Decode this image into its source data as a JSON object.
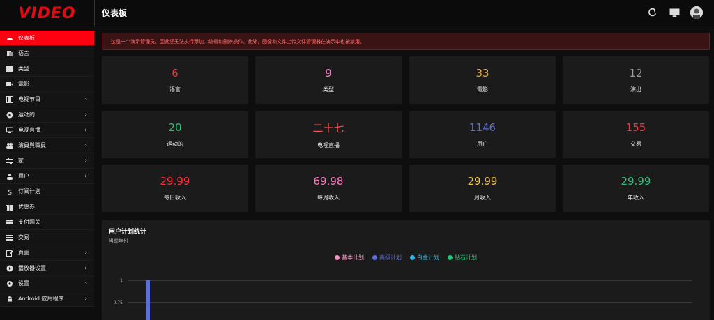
{
  "app": {
    "logo": "VIDEO",
    "page_title": "仪表板"
  },
  "sidebar": {
    "items": [
      {
        "label": "仪表板",
        "icon": "dashboard-icon",
        "active": true,
        "chevron": false
      },
      {
        "label": "语言",
        "icon": "language-icon",
        "chevron": false
      },
      {
        "label": "类型",
        "icon": "list-icon",
        "chevron": false
      },
      {
        "label": "電影",
        "icon": "video-icon",
        "chevron": false
      },
      {
        "label": "电视节目",
        "icon": "film-icon",
        "chevron": true
      },
      {
        "label": "运动的",
        "icon": "ball-icon",
        "chevron": true
      },
      {
        "label": "电视直播",
        "icon": "tv-icon",
        "chevron": true
      },
      {
        "label": "演員與職員",
        "icon": "users-icon",
        "chevron": true
      },
      {
        "label": "家",
        "icon": "sliders-icon",
        "chevron": true
      },
      {
        "label": "用户",
        "icon": "user-group-icon",
        "chevron": true
      },
      {
        "label": "订阅计划",
        "icon": "dollar-icon",
        "chevron": false
      },
      {
        "label": "优惠券",
        "icon": "gift-icon",
        "chevron": false
      },
      {
        "label": "支付网关",
        "icon": "credit-card-icon",
        "chevron": false
      },
      {
        "label": "交易",
        "icon": "list-icon",
        "chevron": false
      },
      {
        "label": "页面",
        "icon": "edit-icon",
        "chevron": true
      },
      {
        "label": "播放器设置",
        "icon": "play-circle-icon",
        "chevron": true
      },
      {
        "label": "设置",
        "icon": "gear-icon",
        "chevron": true
      },
      {
        "label": "Android 应用程序",
        "icon": "android-icon",
        "chevron": true
      }
    ],
    "chevron_glyph": "›"
  },
  "alert": {
    "text": "这是一个演示管理员。因此您无法执行添加、编辑和删除操作。此外，图像和文件上传文件管理器在演示中也被禁用。"
  },
  "stats": [
    {
      "value": "6",
      "label": "语言",
      "color": "#ff2d3d"
    },
    {
      "value": "9",
      "label": "类型",
      "color": "#ff7ac0"
    },
    {
      "value": "33",
      "label": "電影",
      "color": "#f5a623"
    },
    {
      "value": "12",
      "label": "演出",
      "color": "#9a9a9a"
    },
    {
      "value": "20",
      "label": "运动的",
      "color": "#27c47a"
    },
    {
      "value": "二十七",
      "label": "电视直播",
      "color": "#ff4b4b"
    },
    {
      "value": "1146",
      "label": "用户",
      "color": "#5b6fd6"
    },
    {
      "value": "155",
      "label": "交易",
      "color": "#ff2d3d"
    },
    {
      "value": "29.99",
      "label": "每日收入",
      "color": "#ff2d3d"
    },
    {
      "value": "69.98",
      "label": "每周收入",
      "color": "#ff7ac0"
    },
    {
      "value": "29.99",
      "label": "月收入",
      "color": "#f5c542"
    },
    {
      "value": "29.99",
      "label": "年收入",
      "color": "#27c47a"
    }
  ],
  "plan": {
    "title": "用户计划统计",
    "subtitle": "当前年份",
    "legend": [
      {
        "name": "基本计划",
        "color": "#ff8fc8"
      },
      {
        "name": "高级计划",
        "color": "#5b6fd6"
      },
      {
        "name": "白金计划",
        "color": "#2bb7e8"
      },
      {
        "name": "钻石计划",
        "color": "#27c47a"
      }
    ]
  },
  "chart_data": {
    "type": "bar",
    "y_ticks": [
      "1",
      "0.75"
    ],
    "series": [
      {
        "name": "高级计划",
        "values": [
          1
        ]
      }
    ],
    "ylim": [
      0,
      1
    ]
  }
}
